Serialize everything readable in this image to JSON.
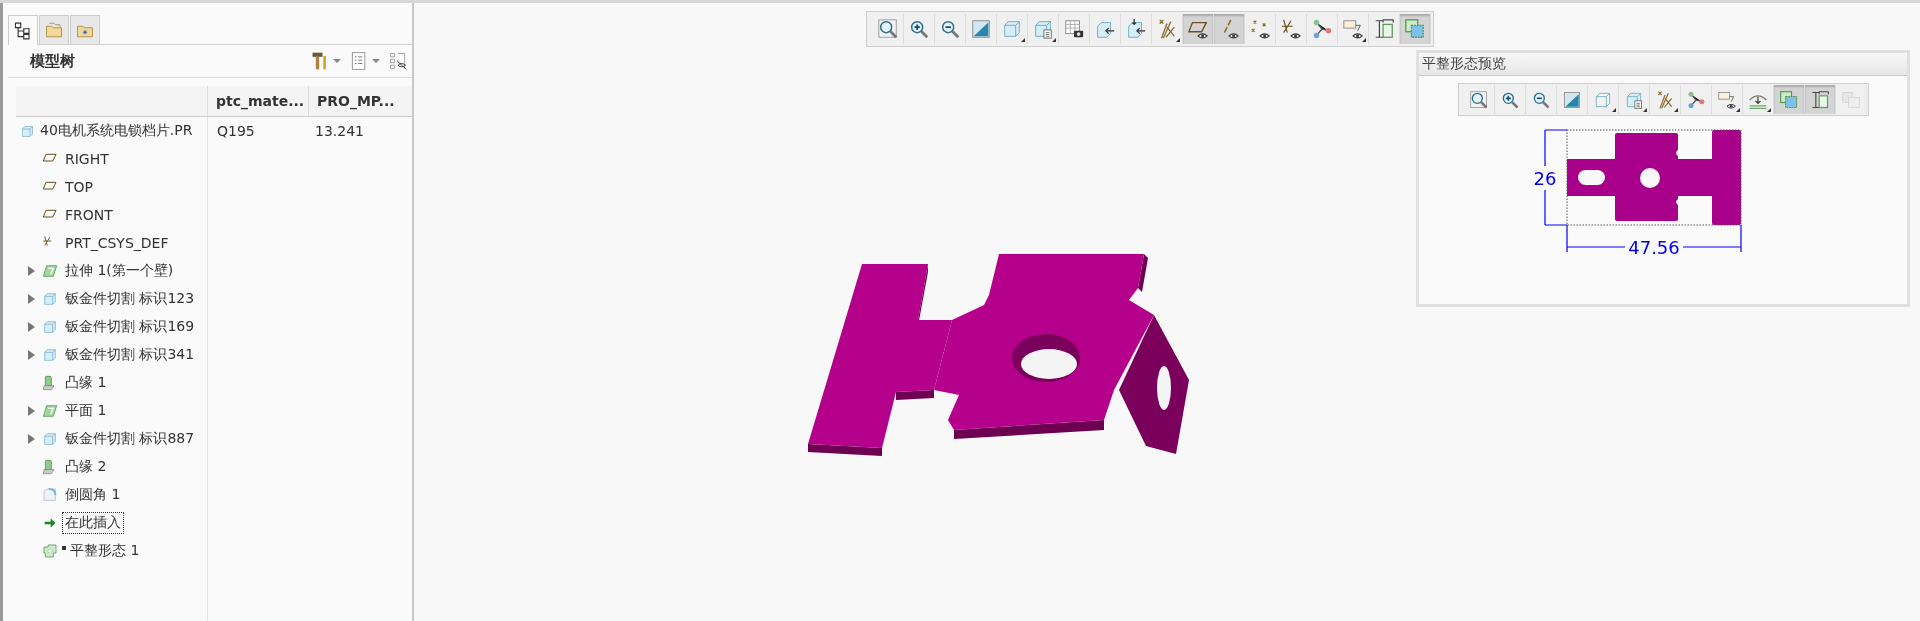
{
  "left_panel": {
    "tabs": [
      {
        "kind": "tree",
        "selected": true
      },
      {
        "kind": "folders",
        "selected": false
      },
      {
        "kind": "favorites",
        "selected": false
      }
    ],
    "title": "模型树",
    "tools": [
      {
        "kind": "settings",
        "dropdown": true
      },
      {
        "kind": "show",
        "dropdown": true
      },
      {
        "kind": "filter",
        "dropdown": false
      }
    ],
    "columns": [
      "ptc_mate...",
      "PRO_MP..."
    ],
    "root": {
      "label": "40电机系统电锁档片.PR",
      "kind": "part",
      "cells": [
        "Q195",
        "13.241"
      ],
      "children": [
        {
          "label": "RIGHT",
          "kind": "plane",
          "expandable": false,
          "selected": false,
          "marker": false
        },
        {
          "label": "TOP",
          "kind": "plane",
          "expandable": false,
          "selected": false,
          "marker": false
        },
        {
          "label": "FRONT",
          "kind": "plane",
          "expandable": false,
          "selected": false,
          "marker": false
        },
        {
          "label": "PRT_CSYS_DEF",
          "kind": "csys",
          "expandable": false,
          "selected": false,
          "marker": false
        },
        {
          "label": "拉伸 1(第一个壁)",
          "kind": "extrude",
          "expandable": true,
          "selected": false,
          "marker": false
        },
        {
          "label": "钣金件切割 标识123",
          "kind": "cut",
          "expandable": true,
          "selected": false,
          "marker": false
        },
        {
          "label": "钣金件切割 标识169",
          "kind": "cut",
          "expandable": true,
          "selected": false,
          "marker": false
        },
        {
          "label": "钣金件切割 标识341",
          "kind": "cut",
          "expandable": true,
          "selected": false,
          "marker": false
        },
        {
          "label": "凸缘 1",
          "kind": "flange",
          "expandable": false,
          "selected": false,
          "marker": false
        },
        {
          "label": "平面 1",
          "kind": "extrude",
          "expandable": true,
          "selected": false,
          "marker": false
        },
        {
          "label": "钣金件切割 标识887",
          "kind": "cut",
          "expandable": true,
          "selected": false,
          "marker": false
        },
        {
          "label": "凸缘 2",
          "kind": "flange",
          "expandable": false,
          "selected": false,
          "marker": false
        },
        {
          "label": "倒圆角 1",
          "kind": "round",
          "expandable": false,
          "selected": false,
          "marker": false
        },
        {
          "label": "在此插入",
          "kind": "insert",
          "expandable": false,
          "selected": true,
          "marker": false
        },
        {
          "label": "平整形态 1",
          "kind": "flat-state",
          "expandable": false,
          "selected": false,
          "marker": true
        }
      ]
    }
  },
  "toolbar": [
    {
      "kind": "zoom-fit",
      "pressed": false,
      "dropdown": false
    },
    {
      "kind": "zoom-in",
      "pressed": false,
      "dropdown": false
    },
    {
      "kind": "zoom-out",
      "pressed": false,
      "dropdown": false
    },
    {
      "kind": "repaint",
      "pressed": false,
      "dropdown": false
    },
    {
      "kind": "cube",
      "pressed": false,
      "dropdown": true
    },
    {
      "kind": "saved-views",
      "pressed": false,
      "dropdown": true
    },
    {
      "kind": "table-camera",
      "pressed": false,
      "dropdown": false
    },
    {
      "kind": "view-back",
      "pressed": false,
      "dropdown": false
    },
    {
      "kind": "view-in",
      "pressed": false,
      "dropdown": false
    },
    {
      "kind": "datum",
      "pressed": false,
      "dropdown": true
    },
    {
      "kind": "plane-display",
      "pressed": true,
      "dropdown": false
    },
    {
      "kind": "axis-display",
      "pressed": true,
      "dropdown": false
    },
    {
      "kind": "point-display",
      "pressed": false,
      "dropdown": false
    },
    {
      "kind": "csys-display",
      "pressed": false,
      "dropdown": false
    },
    {
      "kind": "connect",
      "pressed": false,
      "dropdown": false
    },
    {
      "kind": "annotation",
      "pressed": false,
      "dropdown": true
    },
    {
      "kind": "dimension-view",
      "pressed": false,
      "dropdown": false
    },
    {
      "kind": "flat-preview",
      "pressed": true,
      "dropdown": false
    }
  ],
  "preview": {
    "title": "平整形态预览",
    "toolbar": [
      {
        "kind": "zoom-fit",
        "pressed": false,
        "dropdown": false,
        "disabled": false
      },
      {
        "kind": "zoom-in",
        "pressed": false,
        "dropdown": false,
        "disabled": false
      },
      {
        "kind": "zoom-out",
        "pressed": false,
        "dropdown": false,
        "disabled": false
      },
      {
        "kind": "repaint",
        "pressed": false,
        "dropdown": false,
        "disabled": false
      },
      {
        "kind": "cube-white",
        "pressed": false,
        "dropdown": true,
        "disabled": false
      },
      {
        "kind": "saved-views",
        "pressed": false,
        "dropdown": true,
        "disabled": false
      },
      {
        "kind": "datum",
        "pressed": false,
        "dropdown": true,
        "disabled": false
      },
      {
        "kind": "connect",
        "pressed": false,
        "dropdown": false,
        "disabled": false
      },
      {
        "kind": "annotation",
        "pressed": false,
        "dropdown": true,
        "disabled": false
      },
      {
        "kind": "bend",
        "pressed": false,
        "dropdown": true,
        "disabled": false
      },
      {
        "kind": "flat-preview",
        "pressed": true,
        "dropdown": false,
        "disabled": false
      },
      {
        "kind": "dimension-view",
        "pressed": true,
        "dropdown": false,
        "disabled": false
      },
      {
        "kind": "sheets",
        "pressed": false,
        "dropdown": false,
        "disabled": true
      }
    ],
    "height_dimension": "26",
    "width_dimension": "47.56"
  }
}
